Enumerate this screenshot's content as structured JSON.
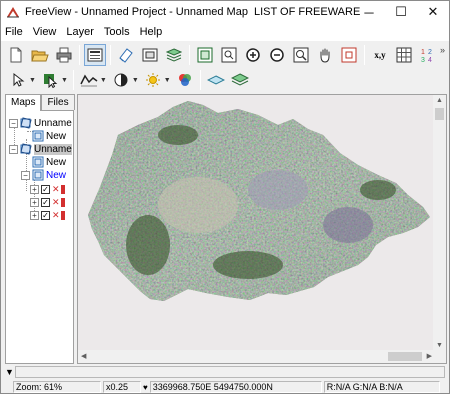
{
  "window": {
    "title": "FreeView - Unnamed Project - Unnamed Map",
    "watermark": "LIST OF FREEWARE",
    "controls": {
      "minimize": "─",
      "maximize": "☐",
      "close": "✕"
    }
  },
  "menu": [
    "File",
    "View",
    "Layer",
    "Tools",
    "Help"
  ],
  "toolbar1": {
    "buttons": [
      "new-file-icon",
      "open-folder-icon",
      "print-icon",
      "map-view-icon",
      "eraser-icon",
      "frame-icon",
      "layers-icon",
      "zoom-extent-icon",
      "zoom-window-icon",
      "zoom-in-icon",
      "zoom-out-icon",
      "zoom-fit-icon",
      "pan-hand-icon",
      "overview-icon",
      "coordinates-icon",
      "grid-icon",
      "numbering-icon"
    ],
    "coord_label": "x,y",
    "num_label": "12/34",
    "overflow": "»"
  },
  "toolbar2": {
    "buttons": [
      "select-arrow-icon",
      "select-layer-icon",
      "measure-icon",
      "contrast-icon",
      "brightness-icon",
      "rgb-icon",
      "layer-flat-icon",
      "layer-stack-icon"
    ]
  },
  "panel": {
    "tabs": [
      "Maps",
      "Files"
    ],
    "tree": [
      {
        "label": "Unname",
        "level": 0
      },
      {
        "label": "New",
        "level": 1
      },
      {
        "label": "Unname",
        "level": 0,
        "selected": true
      },
      {
        "label": "New",
        "level": 1
      },
      {
        "label": "New",
        "level": 1,
        "blue": true
      },
      {
        "label": "",
        "level": 2
      },
      {
        "label": "",
        "level": 2
      },
      {
        "label": "",
        "level": 2
      }
    ]
  },
  "status": {
    "zoom": "Zoom: 61%",
    "scale": "x0.25",
    "coords": "3369968.750E 5494750.000N",
    "rgb": "R:N/A G:N/A B:N/A"
  },
  "colors": {
    "map_green": "#3f5a2a",
    "map_light": "#b8b6a2",
    "map_violet": "#7b6f96",
    "background": "#ece9ea"
  }
}
